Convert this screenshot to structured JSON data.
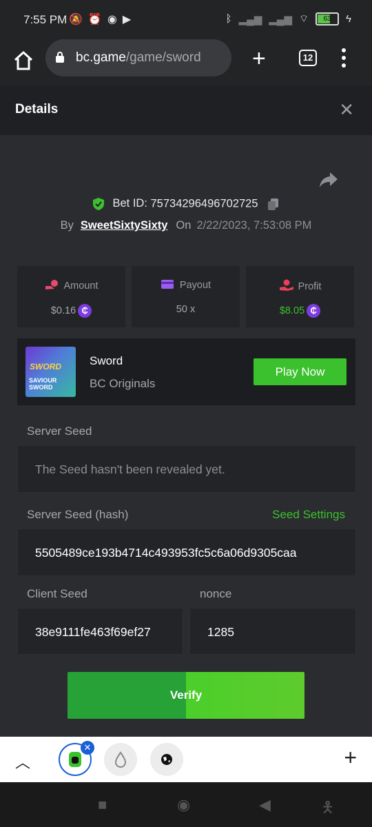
{
  "status": {
    "time": "7:55 PM",
    "battery": "63"
  },
  "browser": {
    "url_domain": "bc.game",
    "url_path": "/game/sword",
    "tab_count": "12"
  },
  "header": {
    "title": "Details",
    "close": "✕"
  },
  "bet": {
    "label": "Bet ID:",
    "id": "75734296496702725",
    "by_label": "By",
    "user": "SweetSixtySixty",
    "on_label": "On",
    "date": "2/22/2023, 7:53:08 PM"
  },
  "stats": {
    "amount": {
      "label": "Amount",
      "value": "$0.16"
    },
    "payout": {
      "label": "Payout",
      "value": "50 x"
    },
    "profit": {
      "label": "Profit",
      "value": "$8.05"
    }
  },
  "game": {
    "name": "Sword",
    "provider": "BC Originals",
    "play": "Play Now",
    "thumb_line1": "SWORD",
    "thumb_line2": "SAVIOUR SWORD"
  },
  "fields": {
    "server_seed_label": "Server Seed",
    "server_seed_value": "The Seed hasn't been revealed yet.",
    "hash_label": "Server Seed (hash)",
    "seed_settings": "Seed Settings",
    "hash_value": "5505489ce193b4714c493953fc5c6a06d9305caa",
    "client_seed_label": "Client Seed",
    "client_seed_value": "38e9111fe463f69ef27",
    "nonce_label": "nonce",
    "nonce_value": "1285"
  },
  "verify": "Verify",
  "colors": {
    "accent_green": "#3bc12d",
    "coin_purple": "#7d3ce0",
    "profit_green": "#3bc12d",
    "tab_blue": "#1a5fd6"
  }
}
